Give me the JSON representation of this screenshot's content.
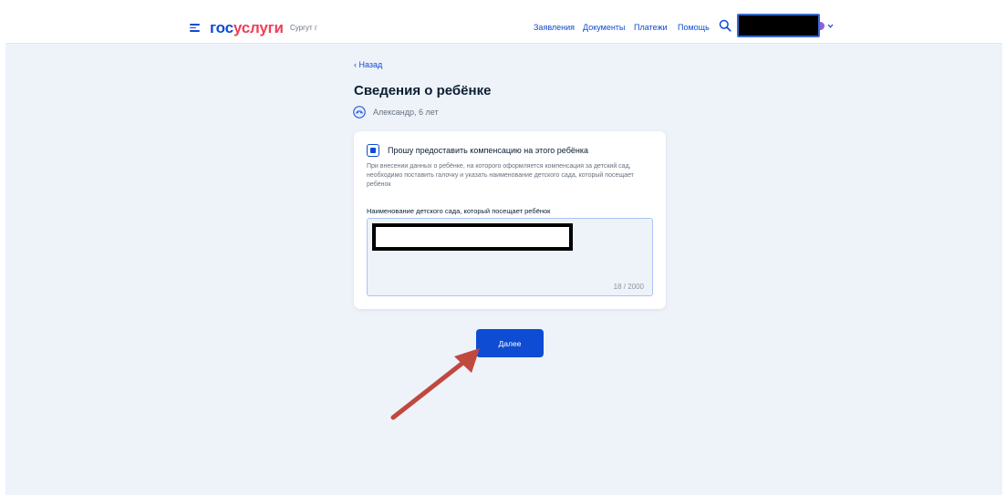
{
  "header": {
    "logo_part1": "гос",
    "logo_part2": "услуги",
    "city": "Сургут г",
    "nav": [
      "Заявления",
      "Документы",
      "Платежи",
      "Помощь"
    ],
    "icons": [
      "menu-icon",
      "search-icon",
      "chevron-down-icon"
    ]
  },
  "main": {
    "back_label": "‹ Назад",
    "title": "Сведения о ребёнке",
    "child_name": "Александр, 6 лет"
  },
  "card": {
    "checkbox_label": "Прошу предоставить компенсацию на этого ребёнка",
    "checkbox_checked": true,
    "hint": "При внесении данных о ребёнке, на которого оформляется компенсация за детский сад, необходимо поставить галочку и указать наименование детского сада, который посещает ребёнок",
    "field_label": "Наименование детского сада, который посещает ребёнок",
    "counter": "18 / 2000"
  },
  "actions": {
    "next_label": "Далее"
  },
  "colors": {
    "brand_blue": "#0d4cd3",
    "brand_red": "#ee3f58",
    "page_bg": "#eef2f9",
    "annotation_arrow": "#c0483f"
  }
}
